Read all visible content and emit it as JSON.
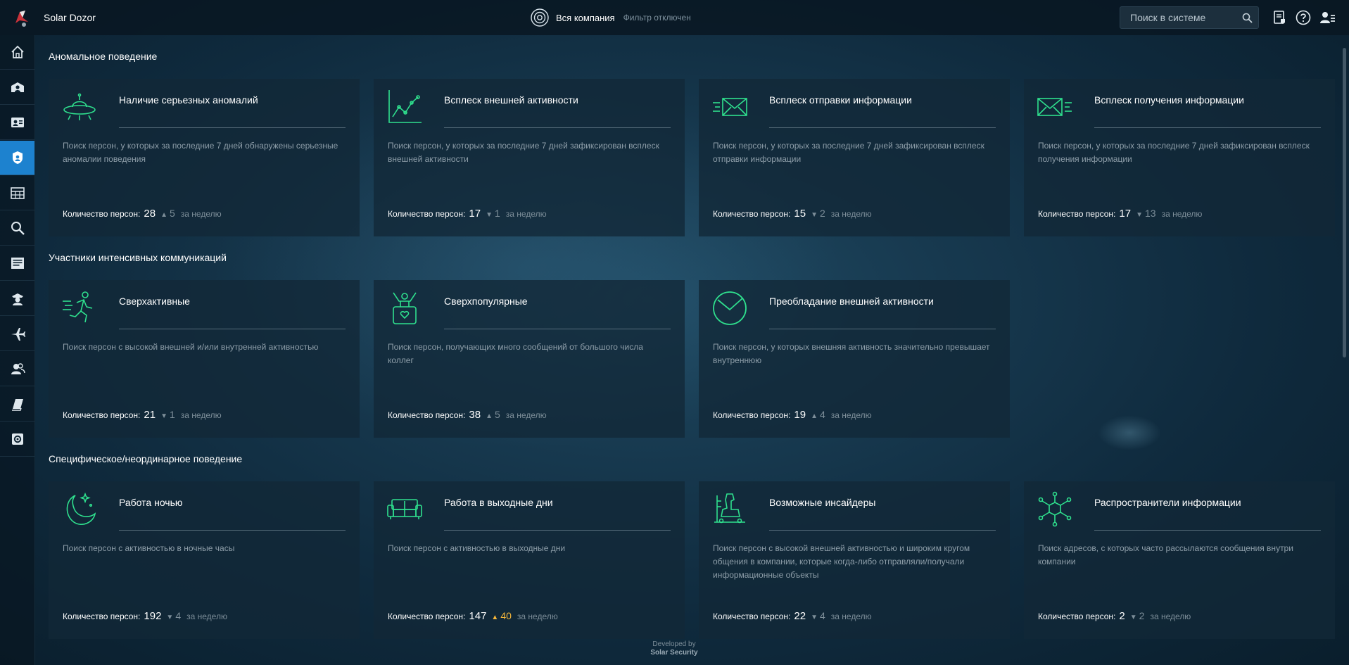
{
  "app": {
    "title": "Solar Dozor"
  },
  "header": {
    "scope_label": "Вся компания",
    "filter_label": "Фильтр отключен",
    "search_placeholder": "Поиск в системе"
  },
  "sidebar": {
    "items": [
      {
        "icon": "home-icon"
      },
      {
        "icon": "organization-icon"
      },
      {
        "icon": "person-card-icon"
      },
      {
        "icon": "behavior-icon",
        "active": true
      },
      {
        "icon": "calendar-table-icon"
      },
      {
        "icon": "search-icon"
      },
      {
        "icon": "list-icon"
      },
      {
        "icon": "agent-icon"
      },
      {
        "icon": "plane-icon"
      },
      {
        "icon": "users-icon"
      },
      {
        "icon": "book-icon"
      },
      {
        "icon": "settings-icon"
      }
    ]
  },
  "footer_labels": {
    "count": "Количество персон:",
    "period": "за неделю"
  },
  "sections": [
    {
      "title": "Аномальное поведение",
      "cards": [
        {
          "icon": "ufo-icon",
          "title": "Наличие серьезных аномалий",
          "desc": "Поиск персон, у которых за последние 7 дней обнаружены серьезные аномалии поведения",
          "count": "28",
          "arrow": "▲",
          "delta": "5",
          "direction": "up",
          "highlight": false
        },
        {
          "icon": "growth-chart-icon",
          "title": "Всплеск внешней активности",
          "desc": "Поиск персон, у которых за последние 7 дней зафиксирован всплеск внешней активности",
          "count": "17",
          "arrow": "▼",
          "delta": "1",
          "direction": "down",
          "highlight": false
        },
        {
          "icon": "send-mail-icon",
          "title": "Всплеск отправки информации",
          "desc": "Поиск персон, у которых за последние 7 дней зафиксирован всплеск отправки информации",
          "count": "15",
          "arrow": "▼",
          "delta": "2",
          "direction": "down",
          "highlight": false
        },
        {
          "icon": "receive-mail-icon",
          "title": "Всплеск получения информации",
          "desc": "Поиск персон, у которых за последние 7 дней зафиксирован всплеск получения информации",
          "count": "17",
          "arrow": "▼",
          "delta": "13",
          "direction": "down",
          "highlight": false
        }
      ]
    },
    {
      "title": "Участники интенсивных коммуникаций",
      "cards": [
        {
          "icon": "runner-icon",
          "title": "Сверхактивные",
          "desc": "Поиск персон с высокой внешней и/или внутренней активностью",
          "count": "21",
          "arrow": "▼",
          "delta": "1",
          "direction": "down",
          "highlight": false
        },
        {
          "icon": "popular-person-icon",
          "title": "Сверхпопулярные",
          "desc": "Поиск персон, получающих много сообщений от большого числа коллег",
          "count": "38",
          "arrow": "▲",
          "delta": "5",
          "direction": "up",
          "highlight": false
        },
        {
          "icon": "pie-chart-icon",
          "title": "Преобладание внешней активности",
          "desc": "Поиск персон, у которых внешняя активность значительно превышает внутреннюю",
          "count": "19",
          "arrow": "▲",
          "delta": "4",
          "direction": "up",
          "highlight": false
        }
      ]
    },
    {
      "title": "Специфическое/неординарное поведение",
      "cards": [
        {
          "icon": "moon-icon",
          "title": "Работа ночью",
          "desc": "Поиск персон с активностью в ночные часы",
          "count": "192",
          "arrow": "▼",
          "delta": "4",
          "direction": "down",
          "highlight": false
        },
        {
          "icon": "sofa-icon",
          "title": "Работа в выходные дни",
          "desc": "Поиск персон с активностью в выходные дни",
          "count": "147",
          "arrow": "▲",
          "delta": "40",
          "direction": "up",
          "highlight": true
        },
        {
          "icon": "trojan-horse-icon",
          "title": "Возможные инсайдеры",
          "desc": "Поиск персон с высокой внешней активностью и широким кругом общения в компании, которые когда-либо отправляли/получали информационные объекты",
          "count": "22",
          "arrow": "▼",
          "delta": "4",
          "direction": "down",
          "highlight": false
        },
        {
          "icon": "distribution-network-icon",
          "title": "Распространители информации",
          "desc": "Поиск адресов, с которых часто рассылаются сообщения внутри компании",
          "count": "2",
          "arrow": "▼",
          "delta": "2",
          "direction": "down",
          "highlight": false
        }
      ]
    }
  ],
  "developed_by": {
    "line1": "Developed by",
    "line2": "Solar Security"
  },
  "colors": {
    "accent": "#1d82cf",
    "icon_green": "#2fe08e",
    "delta_hot": "#f4b63a"
  }
}
